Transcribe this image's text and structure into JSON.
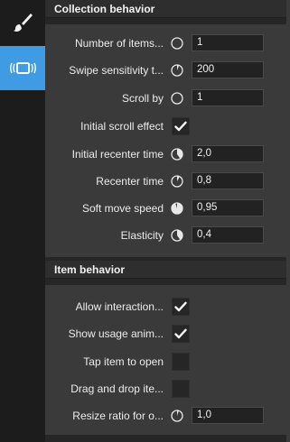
{
  "sidebar": {
    "items": [
      {
        "name": "brush-icon"
      },
      {
        "name": "collection-icon",
        "active": true
      }
    ],
    "accent": "#3f9be3"
  },
  "collection": {
    "title": "Collection behavior",
    "rows": [
      {
        "label": "Number of items...",
        "value": "1",
        "knob": "0"
      },
      {
        "label": "Swipe sensitivity t...",
        "value": "200",
        "knob": "0.06"
      },
      {
        "label": "Scroll by",
        "value": "1",
        "knob": "0"
      },
      {
        "label": "Initial scroll effect",
        "checked": true
      },
      {
        "label": "Initial recenter time",
        "value": "2,0",
        "knob": "0.4"
      },
      {
        "label": "Recenter time",
        "value": "0,8",
        "knob": "0.08"
      },
      {
        "label": "Soft move speed",
        "value": "0,95",
        "knob": "0.95"
      },
      {
        "label": "Elasticity",
        "value": "0,4",
        "knob": "0.4"
      }
    ]
  },
  "item": {
    "title": "Item behavior",
    "rows": [
      {
        "label": "Allow interaction...",
        "checked": true
      },
      {
        "label": "Show usage anim...",
        "checked": true
      },
      {
        "label": "Tap item to open",
        "checked": false
      },
      {
        "label": "Drag and drop ite...",
        "checked": false
      },
      {
        "label": "Resize ratio for o...",
        "value": "1,0",
        "knob": "0.05"
      }
    ]
  }
}
